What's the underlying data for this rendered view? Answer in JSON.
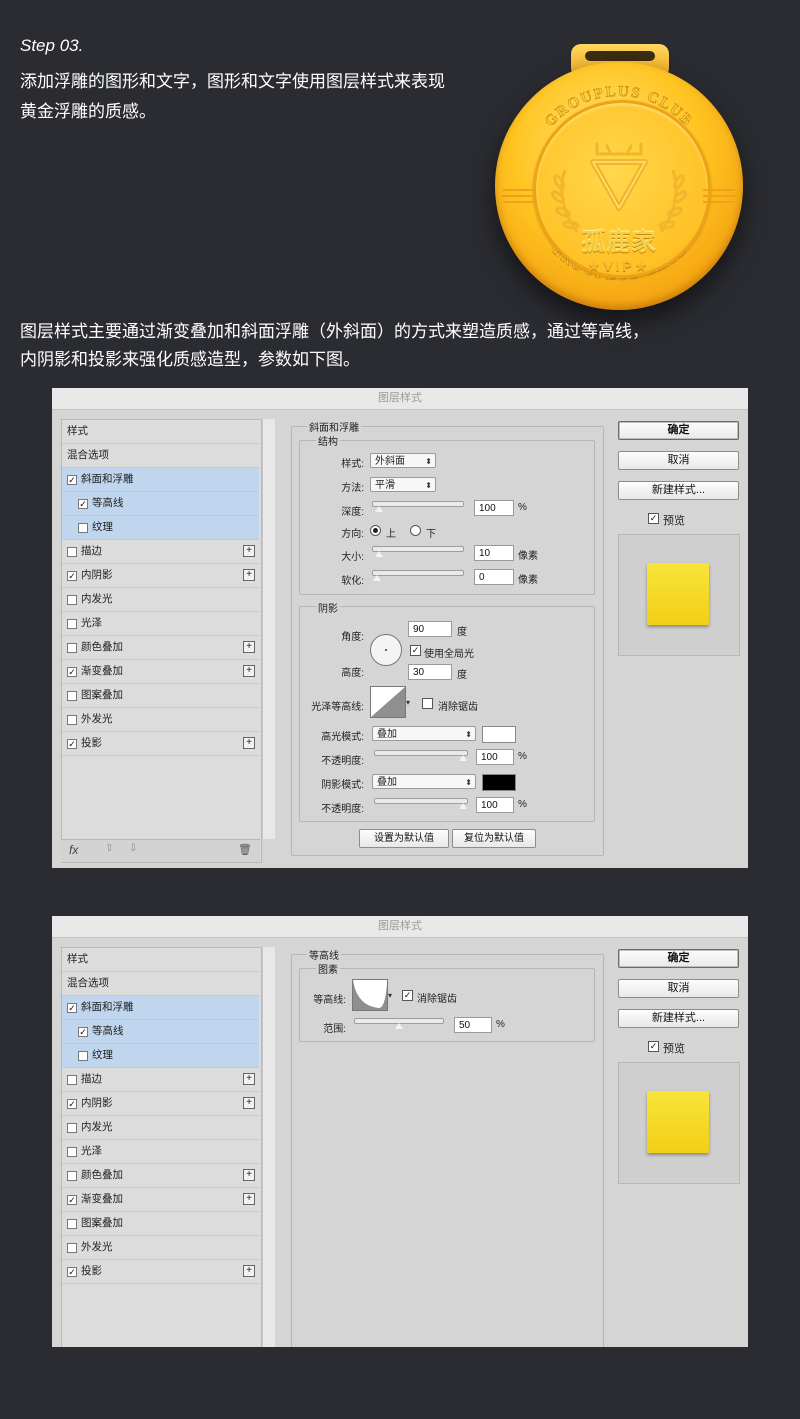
{
  "intro": {
    "step": "Step 03.",
    "line1": "添加浮雕的图形和文字，图形和文字使用图层样式来表现",
    "line2": "黄金浮雕的质感。",
    "desc1": "图层样式主要通过渐变叠加和斜面浮雕（外斜面）的方式来塑造质感，通过等高线，",
    "desc2": "内阴影和投影来强化质感造型，参数如下图。"
  },
  "medal": {
    "arc_top": "GROUPLUS CLUB",
    "arc_bottom": "GROUPLUS CLUB",
    "brand": "孤鹿家",
    "vip": "★VIP★",
    "colors": {
      "gold_light": "#ffe370",
      "gold": "#ffc421",
      "gold_dark": "#d98a0a"
    }
  },
  "dialog1": {
    "title": "图层样式",
    "left_items": [
      {
        "label": "样式",
        "checkbox": false,
        "checked": false,
        "plus": false,
        "selected": false,
        "indent": false
      },
      {
        "label": "混合选项",
        "checkbox": false,
        "checked": false,
        "plus": false,
        "selected": false,
        "indent": false
      },
      {
        "label": "斜面和浮雕",
        "checkbox": true,
        "checked": true,
        "plus": false,
        "selected": true,
        "indent": false
      },
      {
        "label": "等高线",
        "checkbox": true,
        "checked": true,
        "plus": false,
        "selected": true,
        "indent": true
      },
      {
        "label": "纹理",
        "checkbox": true,
        "checked": false,
        "plus": false,
        "selected": true,
        "indent": true
      },
      {
        "label": "描边",
        "checkbox": true,
        "checked": false,
        "plus": true,
        "selected": false,
        "indent": false
      },
      {
        "label": "内阴影",
        "checkbox": true,
        "checked": true,
        "plus": true,
        "selected": false,
        "indent": false
      },
      {
        "label": "内发光",
        "checkbox": true,
        "checked": false,
        "plus": false,
        "selected": false,
        "indent": false
      },
      {
        "label": "光泽",
        "checkbox": true,
        "checked": false,
        "plus": false,
        "selected": false,
        "indent": false
      },
      {
        "label": "颜色叠加",
        "checkbox": true,
        "checked": false,
        "plus": true,
        "selected": false,
        "indent": false
      },
      {
        "label": "渐变叠加",
        "checkbox": true,
        "checked": true,
        "plus": true,
        "selected": false,
        "indent": false
      },
      {
        "label": "图案叠加",
        "checkbox": true,
        "checked": false,
        "plus": false,
        "selected": false,
        "indent": false
      },
      {
        "label": "外发光",
        "checkbox": true,
        "checked": false,
        "plus": false,
        "selected": false,
        "indent": false
      },
      {
        "label": "投影",
        "checkbox": true,
        "checked": true,
        "plus": true,
        "selected": false,
        "indent": false
      }
    ],
    "footer": {
      "fx": "fx",
      "up": "⇧",
      "down": "⇩",
      "trash": "🗑"
    },
    "bevel": {
      "group_title": "斜面和浮雕",
      "structure_title": "结构",
      "style_label": "样式:",
      "style_value": "外斜面",
      "technique_label": "方法:",
      "technique_value": "平滑",
      "depth_label": "深度:",
      "depth_value": "100",
      "depth_unit": "%",
      "direction_label": "方向:",
      "dir_up": "上",
      "dir_down": "下",
      "size_label": "大小:",
      "size_value": "10",
      "size_unit": "像素",
      "soften_label": "软化:",
      "soften_value": "0",
      "soften_unit": "像素",
      "shading_title": "阴影",
      "angle_label": "角度:",
      "angle_value": "90",
      "angle_unit": "度",
      "global_light": "使用全局光",
      "altitude_label": "高度:",
      "altitude_value": "30",
      "altitude_unit": "度",
      "gloss_label": "光泽等高线:",
      "antialias": "消除锯齿",
      "hl_mode_label": "高光模式:",
      "hl_mode_value": "叠加",
      "hl_opacity_label": "不透明度:",
      "hl_opacity_value": "100",
      "hl_opacity_unit": "%",
      "sh_mode_label": "阴影模式:",
      "sh_mode_value": "叠加",
      "sh_opacity_label": "不透明度:",
      "sh_opacity_value": "100",
      "sh_opacity_unit": "%",
      "make_default": "设置为默认值",
      "reset_default": "复位为默认值",
      "hl_color": "#ffffff",
      "sh_color": "#000000",
      "depth_pct": 3,
      "size_pct": 3,
      "soften_pct": 0,
      "hl_opacity_pct": 100,
      "sh_opacity_pct": 100
    },
    "buttons": {
      "ok": "确定",
      "cancel": "取消",
      "new_style": "新建样式...",
      "preview": "预览"
    }
  },
  "dialog2": {
    "title": "图层样式",
    "contour": {
      "group_title": "等高线",
      "sub_title": "图素",
      "contour_label": "等高线:",
      "antialias": "消除锯齿",
      "range_label": "范围:",
      "range_value": "50",
      "range_unit": "%",
      "range_pct": 50
    },
    "buttons": {
      "ok": "确定",
      "cancel": "取消",
      "new_style": "新建样式...",
      "preview": "预览"
    }
  }
}
